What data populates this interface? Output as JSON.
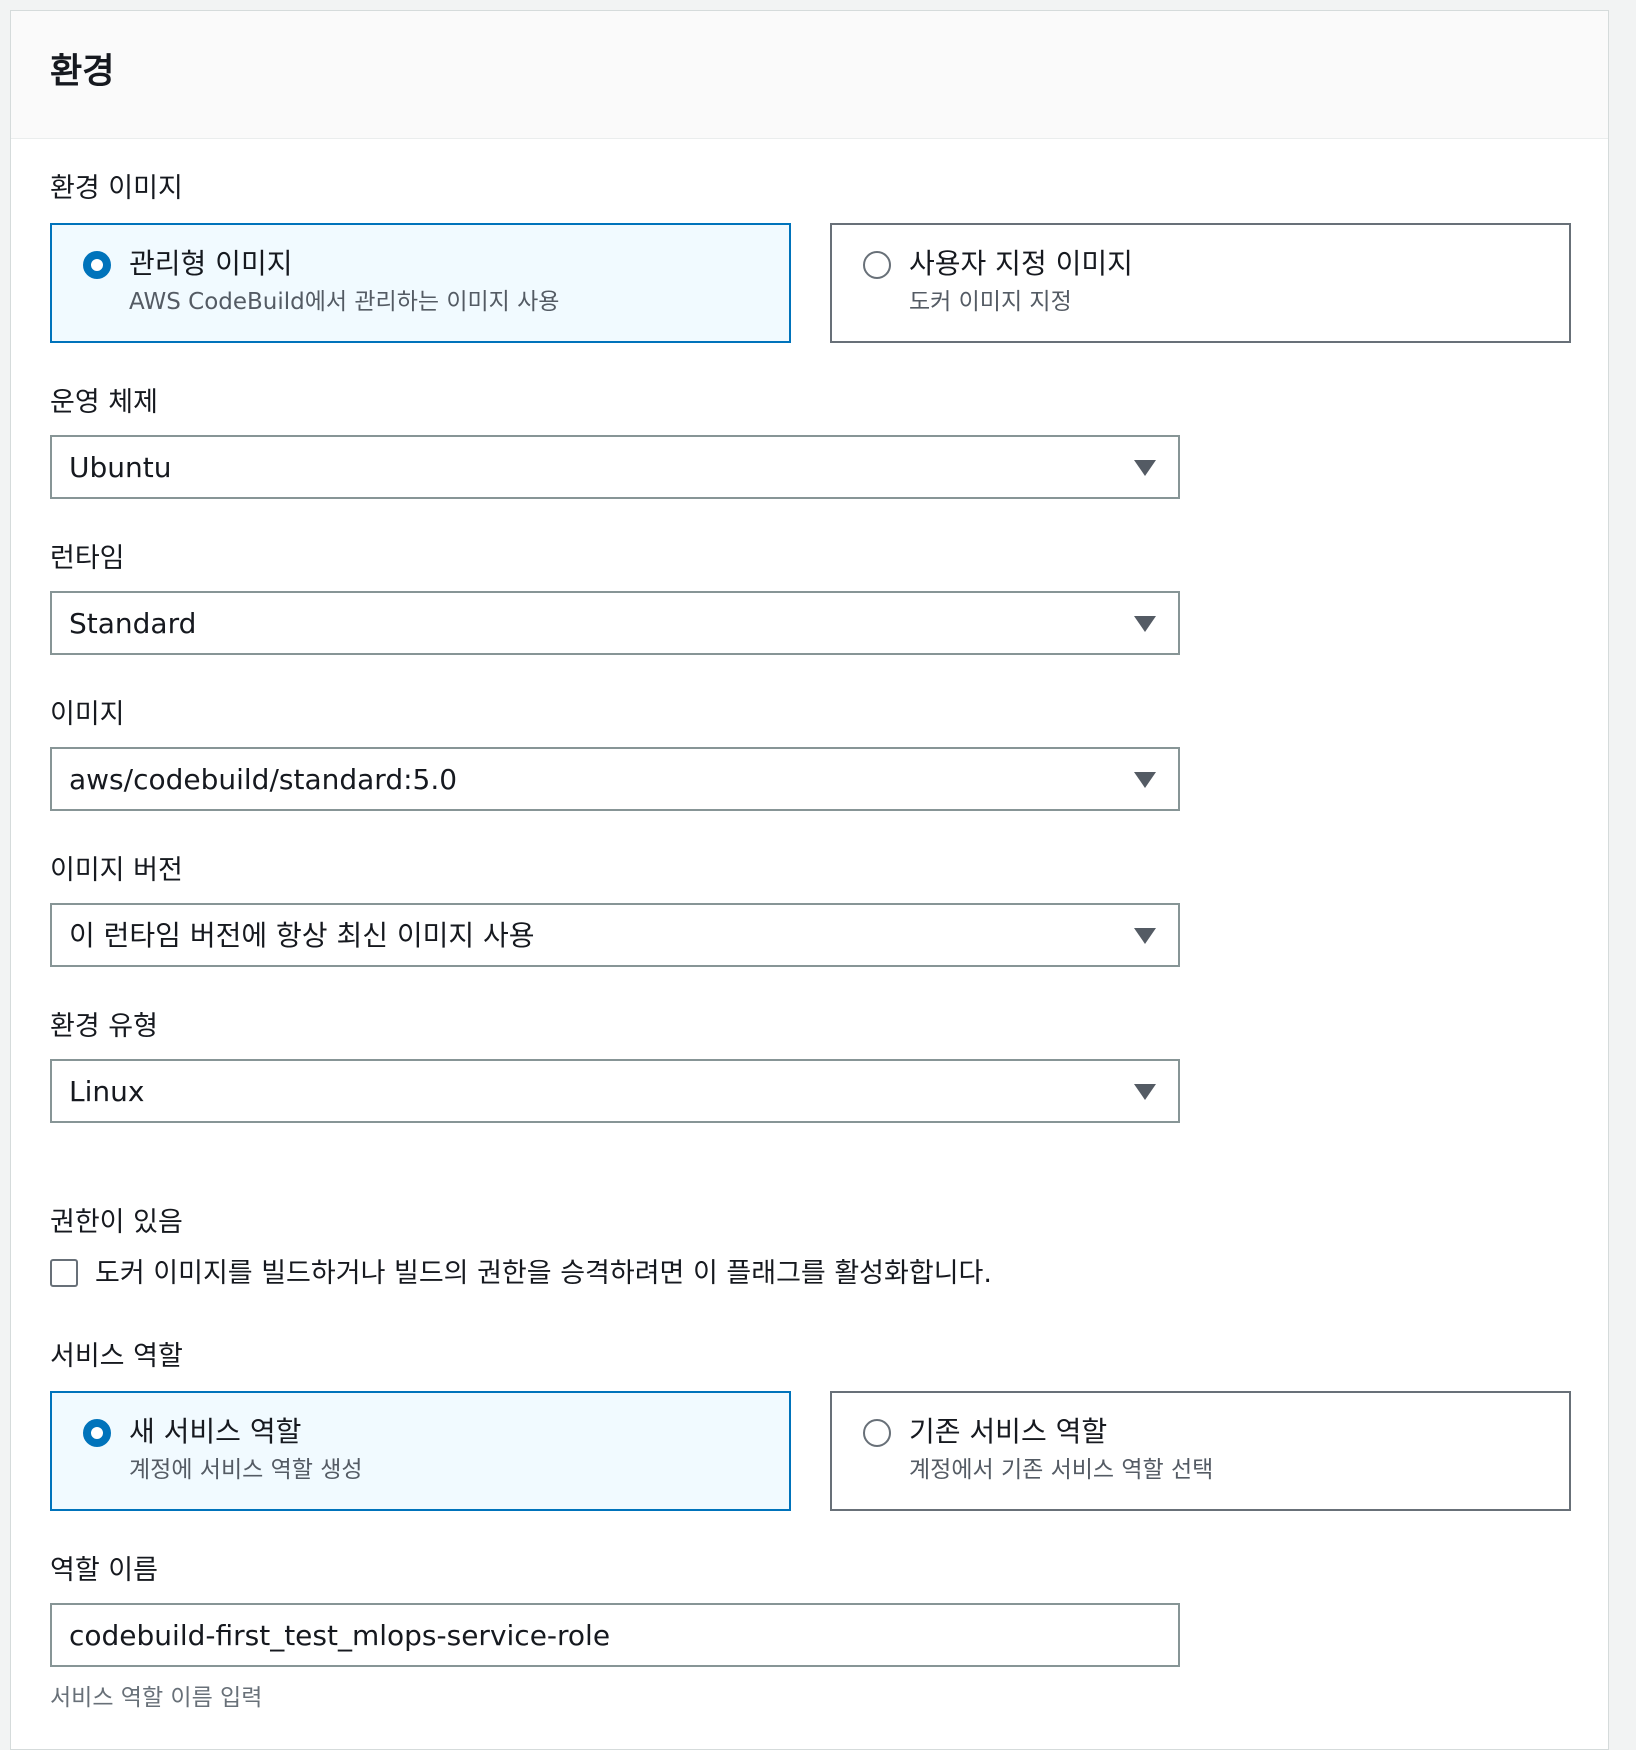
{
  "section": {
    "title": "환경"
  },
  "environment_image": {
    "label": "환경 이미지",
    "options": [
      {
        "title": "관리형 이미지",
        "description": "AWS CodeBuild에서 관리하는 이미지 사용",
        "selected": true
      },
      {
        "title": "사용자 지정 이미지",
        "description": "도커 이미지 지정",
        "selected": false
      }
    ]
  },
  "operating_system": {
    "label": "운영 체제",
    "value": "Ubuntu"
  },
  "runtime": {
    "label": "런타임",
    "value": "Standard"
  },
  "image": {
    "label": "이미지",
    "value": "aws/codebuild/standard:5.0"
  },
  "image_version": {
    "label": "이미지 버전",
    "value": "이 런타임 버전에 항상 최신 이미지 사용"
  },
  "environment_type": {
    "label": "환경 유형",
    "value": "Linux"
  },
  "privileged": {
    "label": "권한이 있음",
    "checkbox_label": "도커 이미지를 빌드하거나 빌드의 권한을 승격하려면 이 플래그를 활성화합니다.",
    "checked": false
  },
  "service_role": {
    "label": "서비스 역할",
    "options": [
      {
        "title": "새 서비스 역할",
        "description": "계정에 서비스 역할 생성",
        "selected": true
      },
      {
        "title": "기존 서비스 역할",
        "description": "계정에서 기존 서비스 역할 선택",
        "selected": false
      }
    ]
  },
  "role_name": {
    "label": "역할 이름",
    "value": "codebuild-first_test_mlops-service-role",
    "hint": "서비스 역할 이름 입력"
  },
  "colors": {
    "accent": "#0073bb",
    "selected_tile_bg": "#f1faff",
    "border": "#879596",
    "secondary_text": "#545b64"
  }
}
